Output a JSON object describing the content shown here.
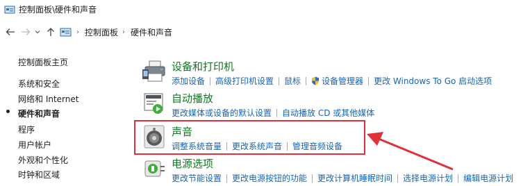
{
  "window": {
    "title": "控制面板\\硬件和声音"
  },
  "nav": {
    "back_icon": "arrow-left-icon",
    "forward_icon": "arrow-right-icon",
    "recent_icon": "chevron-down-icon",
    "up_icon": "arrow-up-icon",
    "breadcrumbs": [
      "控制面板",
      "硬件和声音"
    ],
    "crumb_separator": "›"
  },
  "sidebar": {
    "home": "控制面板主页",
    "items": [
      {
        "label": "系统和安全",
        "current": false
      },
      {
        "label": "网络和 Internet",
        "current": false
      },
      {
        "label": "硬件和声音",
        "current": true
      },
      {
        "label": "程序",
        "current": false
      },
      {
        "label": "用户帐户",
        "current": false
      },
      {
        "label": "外观和个性化",
        "current": false
      },
      {
        "label": "时钟和区域",
        "current": false
      }
    ]
  },
  "categories": [
    {
      "title": "设备和打印机",
      "icon": "printer-icon",
      "links": [
        "添加设备",
        "高级打印机设置",
        "鼠标",
        "设备管理器",
        "更改 Windows To Go 启动选项"
      ]
    },
    {
      "title": "自动播放",
      "icon": "autoplay-icon",
      "links": [
        "更改媒体或设备的默认设置",
        "自动播放 CD 或其他媒体"
      ]
    },
    {
      "title": "声音",
      "icon": "speaker-icon",
      "links": [
        "调整系统音量",
        "更改系统声音",
        "管理音频设备"
      ]
    },
    {
      "title": "电源选项",
      "icon": "power-plug-icon",
      "links": [
        "更改节能设置",
        "更改电源按钮的功能",
        "更改计算机睡眠时间",
        "选择电源计划",
        "编辑电源计划"
      ]
    }
  ],
  "annotation": {
    "box_color": "#e0303a",
    "arrow_color": "#e0303a"
  },
  "colors": {
    "category_title": "#0f7a20",
    "link": "#1565b8"
  }
}
